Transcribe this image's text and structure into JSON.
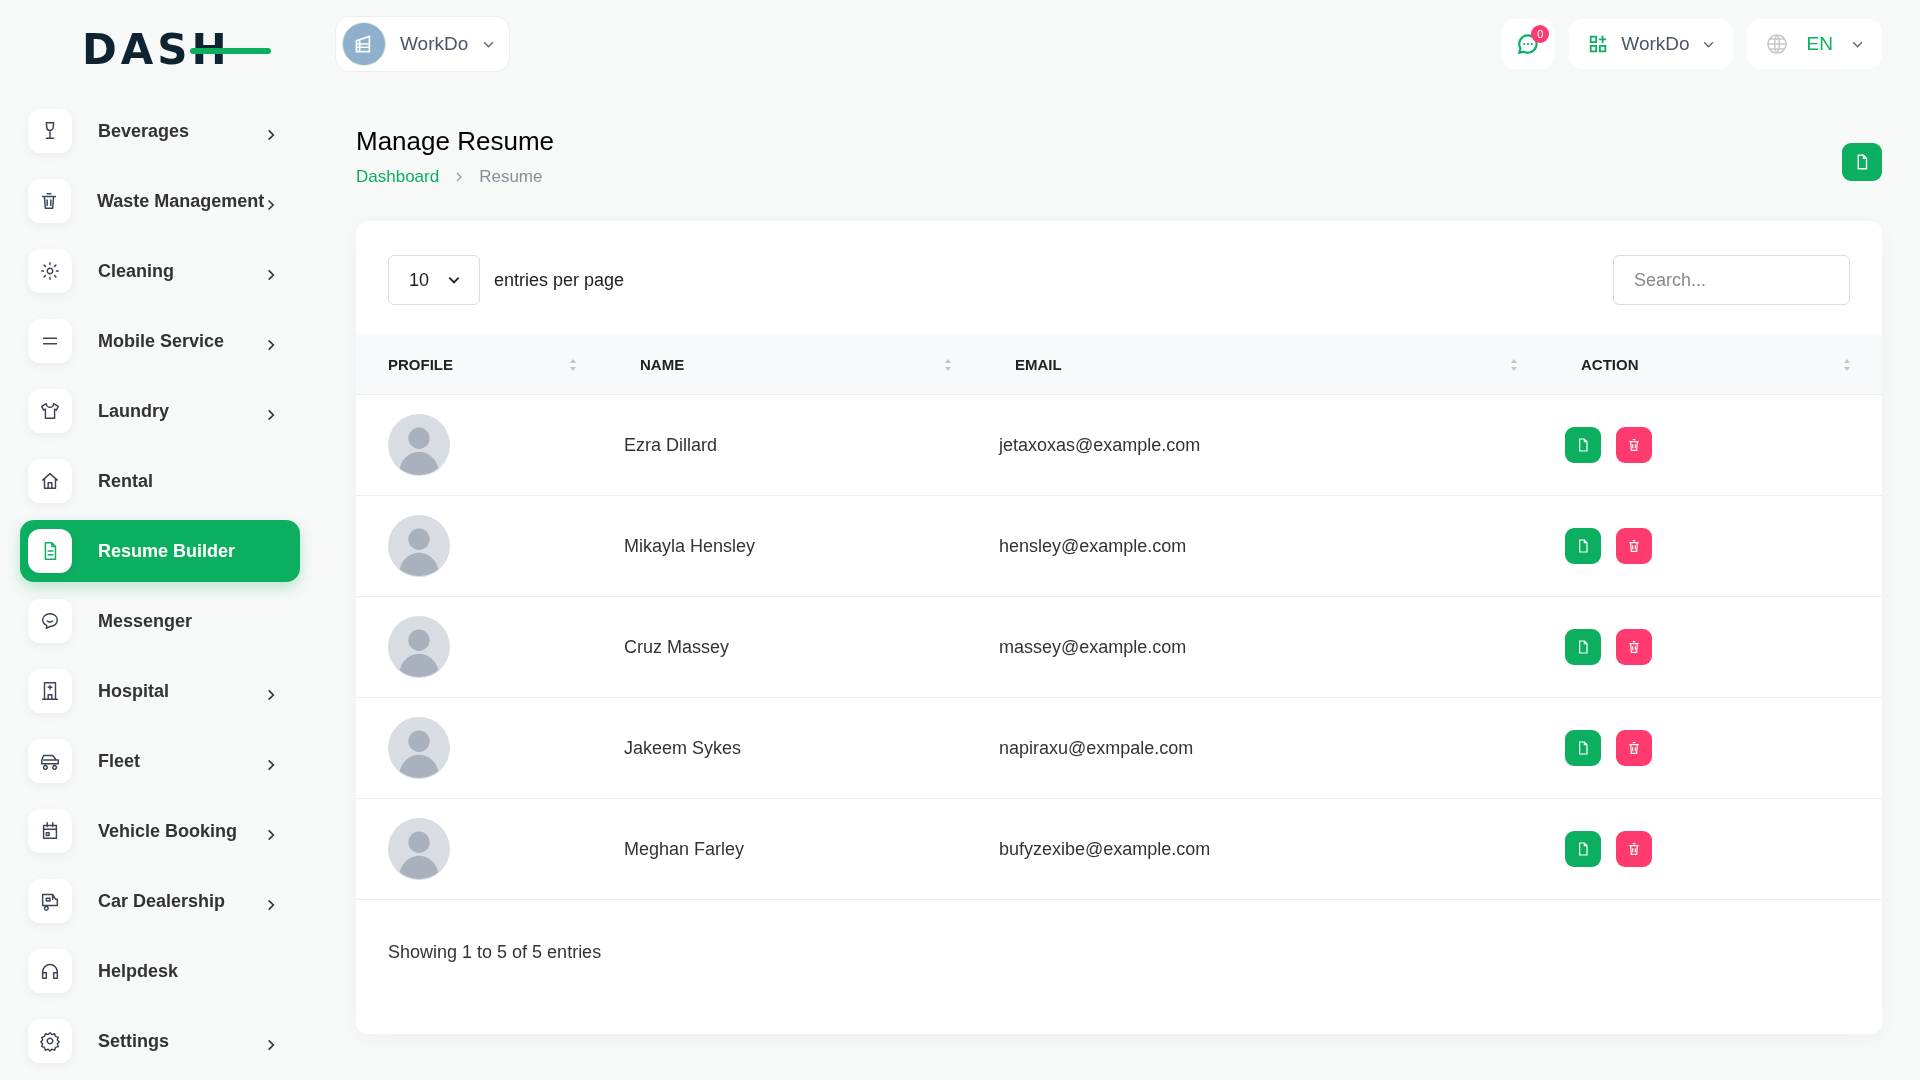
{
  "logo": {
    "text": "DASH"
  },
  "sidebar": {
    "items": [
      {
        "label": "Beverages",
        "expandable": true,
        "selected": false
      },
      {
        "label": "Waste Management",
        "expandable": true,
        "selected": false
      },
      {
        "label": "Cleaning",
        "expandable": true,
        "selected": false
      },
      {
        "label": "Mobile Service",
        "expandable": true,
        "selected": false
      },
      {
        "label": "Laundry",
        "expandable": true,
        "selected": false
      },
      {
        "label": "Rental",
        "expandable": false,
        "selected": false
      },
      {
        "label": "Resume Builder",
        "expandable": false,
        "selected": true
      },
      {
        "label": "Messenger",
        "expandable": false,
        "selected": false
      },
      {
        "label": "Hospital",
        "expandable": true,
        "selected": false
      },
      {
        "label": "Fleet",
        "expandable": true,
        "selected": false
      },
      {
        "label": "Vehicle Booking",
        "expandable": true,
        "selected": false
      },
      {
        "label": "Car Dealership",
        "expandable": true,
        "selected": false
      },
      {
        "label": "Helpdesk",
        "expandable": false,
        "selected": false
      },
      {
        "label": "Settings",
        "expandable": true,
        "selected": false
      }
    ]
  },
  "topbar": {
    "company": "WorkDo",
    "notifications": "0",
    "workspace": "WorkDo",
    "language": "EN"
  },
  "page": {
    "title": "Manage Resume",
    "breadcrumb": [
      {
        "label": "Dashboard",
        "link": true
      },
      {
        "label": "Resume",
        "link": false
      }
    ]
  },
  "table": {
    "page_size": "10",
    "page_size_label": "entries per page",
    "search": {
      "placeholder": "Search..."
    },
    "columns": [
      "PROFILE",
      "NAME",
      "EMAIL",
      "ACTION"
    ],
    "rows": [
      {
        "name": "Ezra Dillard",
        "email": "jetaxoxas@example.com"
      },
      {
        "name": "Mikayla Hensley",
        "email": "hensley@example.com"
      },
      {
        "name": "Cruz Massey",
        "email": "massey@example.com"
      },
      {
        "name": "Jakeem Sykes",
        "email": "napiraxu@exmpale.com"
      },
      {
        "name": "Meghan Farley",
        "email": "bufyzexibe@example.com"
      }
    ],
    "footer": "Showing 1 to 5 of 5 entries"
  }
}
